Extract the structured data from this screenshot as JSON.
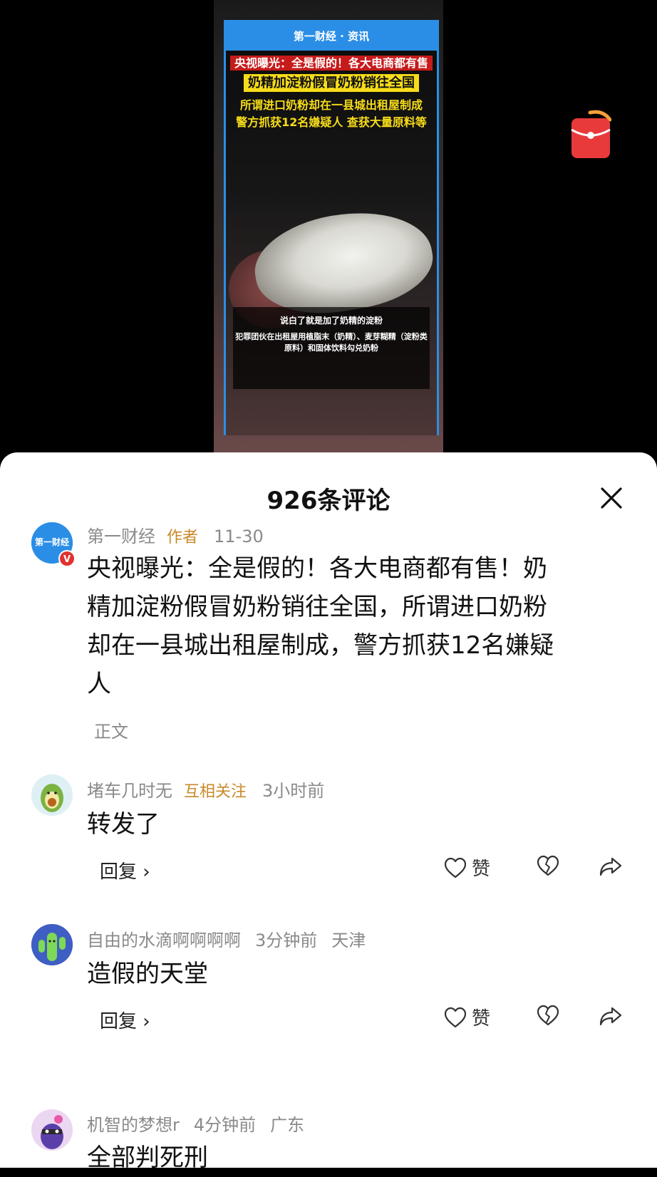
{
  "video": {
    "header": "第一财经 · 资讯",
    "headline_1": "央视曝光：全是假的！各大电商都有售",
    "headline_2": "奶精加淀粉假冒奶粉销往全国",
    "headline_3": "所谓进口奶粉却在一县城出租屋制成",
    "headline_4": "警方抓获12名嫌疑人 查获大量原料等",
    "subtitle_1": "说白了就是加了奶精的淀粉",
    "subtitle_2": "犯罪团伙在出租屋用植脂末（奶精）、麦芽糊精（淀粉类原料）和固体饮料勾兑奶粉"
  },
  "comments_sheet": {
    "title": "926条评论",
    "close_icon": "close-icon"
  },
  "comments": [
    {
      "user": "第一财经",
      "tag": "作者",
      "time": "11-30",
      "text_lines": [
        "央视曝光：全是假的！各大电商都有售！奶",
        "精加淀粉假冒奶粉销往全国，所谓进口奶粉",
        "却在一县城出租屋制成，警方抓获12名嫌疑",
        "人"
      ],
      "sub": "正文",
      "avatar_text": "第一财经"
    },
    {
      "user": "堵车几时无",
      "tag": "互相关注",
      "time": "3小时前",
      "text": "转发了",
      "reply": "回复 ›",
      "like": "赞"
    },
    {
      "user": "自由的水滴啊啊啊啊",
      "time": "3分钟前",
      "location": "天津",
      "text": "造假的天堂",
      "reply": "回复 ›",
      "like": "赞"
    },
    {
      "user": "机智的梦想r",
      "time": "4分钟前",
      "location": "广东",
      "text": "全部判死刑"
    }
  ],
  "colors": {
    "brand_blue": "#2b8ee6",
    "author_tag": "#c88a2a",
    "meta_gray": "#8a8a8a"
  }
}
